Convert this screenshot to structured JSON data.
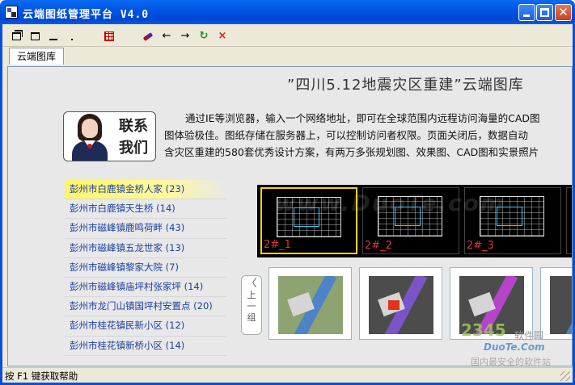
{
  "window": {
    "title": "云端图纸管理平台  V4.0",
    "min_label": "",
    "max_label": "",
    "close_label": "✕"
  },
  "toolbar": {
    "icons": [
      "restore-icon",
      "maximize-icon",
      "minimize-icon",
      "dot-icon",
      "grid-icon",
      "pen-icon",
      "back-arrow-icon",
      "forward-arrow-icon",
      "refresh-icon",
      "stop-icon"
    ],
    "back": "←",
    "forward": "→",
    "refresh": "↻",
    "stop": "×"
  },
  "tab": {
    "label": "云端图库"
  },
  "page": {
    "title": "”四川5.12地震灾区重建”云端图库",
    "intro_lines": [
      "通过IE等浏览器，输入一个网络地址，即可在全球范围内远程访问海量的CAD图",
      "图体验极佳。图纸存储在服务器上，可以控制访问者权限。页面关闭后，数据自动",
      "含灾区重建的580套优秀设计方案，有两万多张规划图、效果图、CAD图和实景照片"
    ],
    "contact_label": "联系我们"
  },
  "sidebar": {
    "items": [
      "彭州市白鹿镇金桥人家 (23)",
      "彭州市白鹿镇天生桥 (14)",
      "彭州市磁峰镇鹿鸣荷畔 (43)",
      "彭州市磁峰镇五龙世家 (13)",
      "彭州市磁峰镇黎家大院 (7)",
      "彭州市磁峰镇庙坪村张家坪 (14)",
      "彭州市龙门山镇国坪村安置点 (20)",
      "彭州市桂花镇民新小区 (12)",
      "彭州市桂花镇新桥小区 (14)"
    ]
  },
  "thumbnails": {
    "cad_labels": [
      "2#_1",
      "2#_2",
      "2#_3"
    ],
    "prev_label_chevron": "〈",
    "prev_label_chars": [
      "上",
      "一",
      "组"
    ]
  },
  "watermarks": {
    "center": "www.DuoTe.com",
    "logo_a": "2345",
    "logo_b": "软件园",
    "logo_c": "DuoTe.Com",
    "logo_d": "国内最安全的软件站"
  },
  "statusbar": {
    "text": "按 F1 键获取帮助"
  },
  "colors": {
    "titlebar": "#0054e3",
    "link": "#1a3fa0",
    "selected_item": "#fff46b",
    "cad_selected_border": "#ffd400",
    "cad_label": "#e0343a"
  }
}
